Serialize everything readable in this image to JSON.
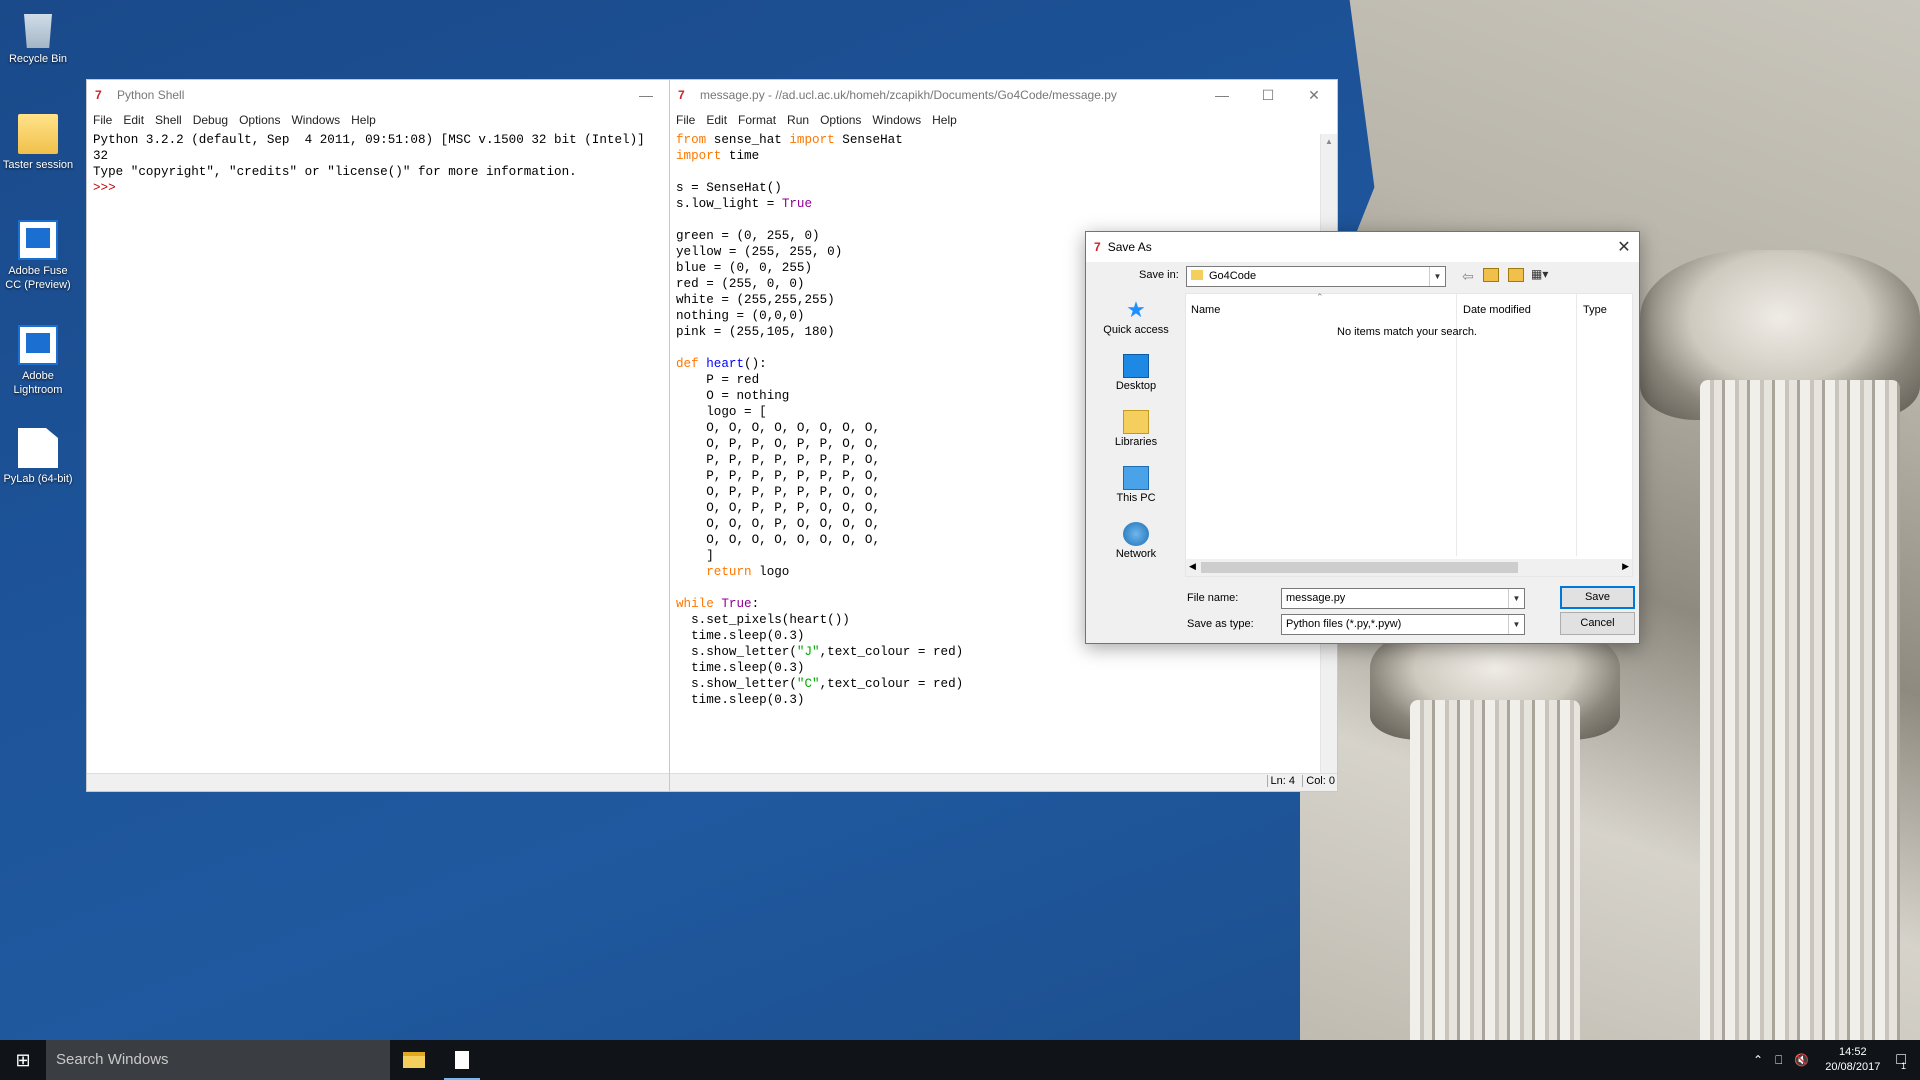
{
  "desktop": {
    "icons": [
      {
        "label": "Recycle Bin"
      },
      {
        "label": "Taster session"
      },
      {
        "label": "Adobe Fuse CC (Preview)"
      },
      {
        "label": "Adobe Lightroom"
      },
      {
        "label": "PyLab (64-bit)"
      }
    ]
  },
  "shell": {
    "title": "Python Shell",
    "menu": [
      "File",
      "Edit",
      "Shell",
      "Debug",
      "Options",
      "Windows",
      "Help"
    ],
    "lines": [
      "Python 3.2.2 (default, Sep  4 2011, 09:51:08) [MSC v.1500 32 bit (Intel)]",
      "32",
      "Type \"copyright\", \"credits\" or \"license()\" for more information."
    ],
    "prompt": ">>>"
  },
  "editor": {
    "title": "message.py - //ad.ucl.ac.uk/homeh/zcapikh/Documents/Go4Code/message.py",
    "menu": [
      "File",
      "Edit",
      "Format",
      "Run",
      "Options",
      "Windows",
      "Help"
    ],
    "status": {
      "line": "Ln: 4",
      "col": "Col: 0"
    },
    "code": {
      "l1_from": "from",
      "l1_mid": " sense_hat ",
      "l1_import": "import",
      "l1_end": " SenseHat",
      "l2_import": "import",
      "l2_end": " time",
      "l4": "s = SenseHat()",
      "l5_a": "s.low_light = ",
      "l5_true": "True",
      "l7": "green = (0, 255, 0)",
      "l8": "yellow = (255, 255, 0)",
      "l9": "blue = (0, 0, 255)",
      "l10": "red = (255, 0, 0)",
      "l11": "white = (255,255,255)",
      "l12": "nothing = (0,0,0)",
      "l13": "pink = (255,105, 180)",
      "l15_def": "def",
      "l15_fn": " heart",
      "l15_end": "():",
      "l16": "    P = red",
      "l17": "    O = nothing",
      "l18": "    logo = [",
      "l19": "    O, O, O, O, O, O, O, O,",
      "l20": "    O, P, P, O, P, P, O, O,",
      "l21": "    P, P, P, P, P, P, P, O,",
      "l22": "    P, P, P, P, P, P, P, O,",
      "l23": "    O, P, P, P, P, P, O, O,",
      "l24": "    O, O, P, P, P, O, O, O,",
      "l25": "    O, O, O, P, O, O, O, O,",
      "l26": "    O, O, O, O, O, O, O, O,",
      "l27": "    ]",
      "l28_ret": "    return",
      "l28_end": " logo",
      "l30_while": "while",
      "l30_sp": " ",
      "l30_true": "True",
      "l30_end": ":",
      "l31": "  s.set_pixels(heart())",
      "l32": "  time.sleep(0.3)",
      "l33_a": "  s.show_letter(",
      "l33_s": "\"J\"",
      "l33_b": ",text_colour = red)",
      "l34": "  time.sleep(0.3)",
      "l35_a": "  s.show_letter(",
      "l35_s": "\"C\"",
      "l35_b": ",text_colour = red)",
      "l36": "  time.sleep(0.3)"
    }
  },
  "dialog": {
    "title": "Save As",
    "save_in_label": "Save in:",
    "save_in_value": "Go4Code",
    "places": [
      "Quick access",
      "Desktop",
      "Libraries",
      "This PC",
      "Network"
    ],
    "columns": [
      "Name",
      "Date modified",
      "Type"
    ],
    "empty_message": "No items match your search.",
    "file_name_label": "File name:",
    "file_name_value": "message.py",
    "save_type_label": "Save as type:",
    "save_type_value": "Python files (*.py,*.pyw)",
    "save_button": "Save",
    "cancel_button": "Cancel"
  },
  "taskbar": {
    "search_placeholder": "Search Windows",
    "time": "14:52",
    "date": "20/08/2017",
    "notifications": "1"
  }
}
